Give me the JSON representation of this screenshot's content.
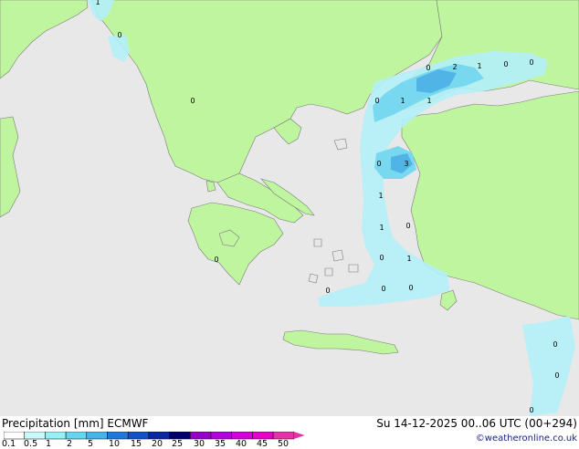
{
  "header": {
    "title_left": "Precipitation [mm]  ECMWF",
    "valid_time": "Su 14-12-2025 00..06 UTC (00+294)",
    "credit": "©weatheronline.co.uk"
  },
  "colors": {
    "sea": "#e8e8e8",
    "land": "#c0f5a0",
    "coast": "#7a7a7a",
    "precip_light": "#b4f0f8",
    "precip_medium": "#78d8f0",
    "precip_heavy": "#50b4e6"
  },
  "legend": {
    "ticks": [
      "0.1",
      "0.5",
      "1",
      "2",
      "5",
      "10",
      "15",
      "20",
      "25",
      "30",
      "35",
      "40",
      "45",
      "50"
    ],
    "colors": [
      "#ffffff",
      "#c8fafa",
      "#96eef6",
      "#64d6f0",
      "#46b4e6",
      "#1e78dc",
      "#1450c8",
      "#0a28a0",
      "#00006e",
      "#9600c8",
      "#b400dc",
      "#d200dc",
      "#e600c8",
      "#e632aa"
    ]
  },
  "map_labels": [
    {
      "text": "1"
    },
    {
      "text": "0"
    },
    {
      "text": "0"
    },
    {
      "text": "0"
    },
    {
      "text": "2"
    },
    {
      "text": "1"
    },
    {
      "text": "0"
    },
    {
      "text": "0"
    },
    {
      "text": "0"
    },
    {
      "text": "1"
    },
    {
      "text": "1"
    },
    {
      "text": "0"
    },
    {
      "text": "3"
    },
    {
      "text": "1"
    },
    {
      "text": "1"
    },
    {
      "text": "0"
    },
    {
      "text": "0"
    },
    {
      "text": "1"
    },
    {
      "text": "0"
    },
    {
      "text": "0"
    },
    {
      "text": "0"
    },
    {
      "text": "0"
    },
    {
      "text": "0"
    },
    {
      "text": "0"
    },
    {
      "text": "0"
    }
  ]
}
